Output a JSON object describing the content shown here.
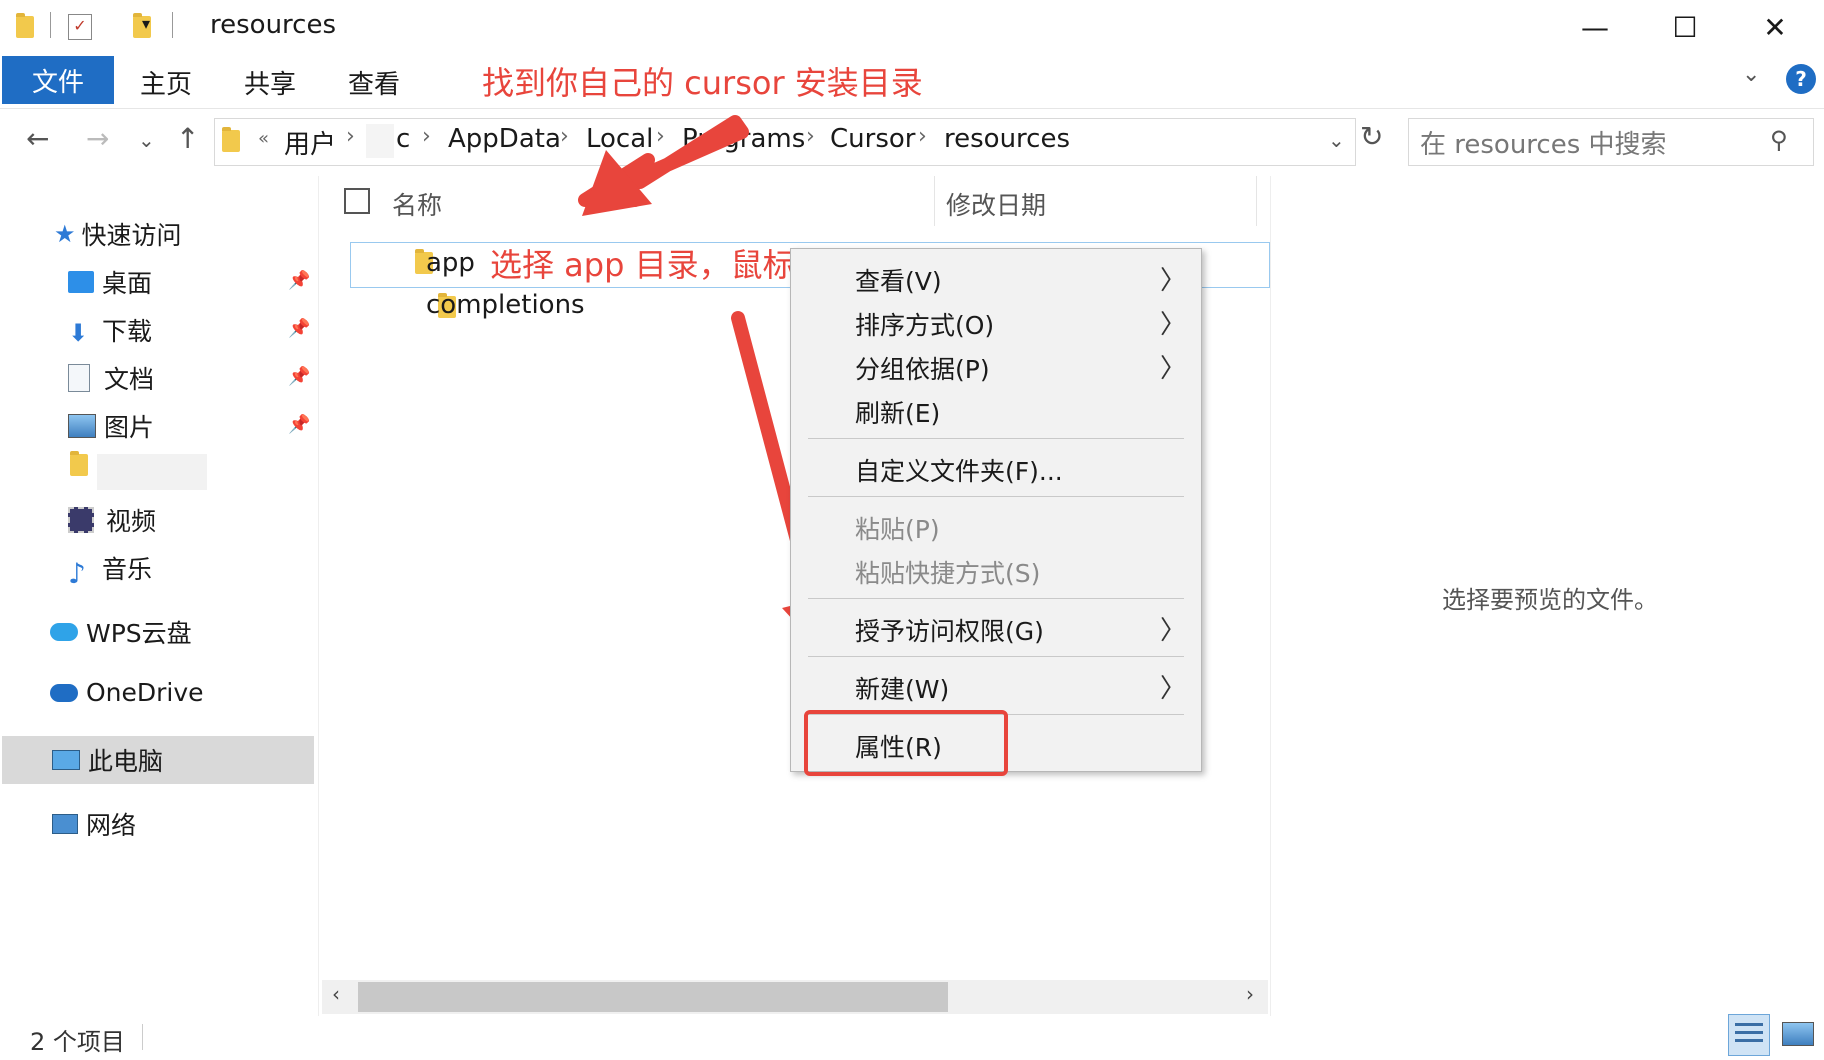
{
  "window": {
    "title": "resources",
    "controls": {
      "minimize": "—",
      "maximize": "☐",
      "close": "✕"
    }
  },
  "ribbon": {
    "tabs": [
      "文件",
      "主页",
      "共享",
      "查看"
    ],
    "help": "?"
  },
  "annotations": {
    "top": "找到你自己的 cursor 安装目录",
    "select": "选择 app 目录，鼠标右键"
  },
  "address": {
    "prefix": "«",
    "crumbs": [
      "用户",
      "c",
      "AppData",
      "Local",
      "Programs",
      "Cursor",
      "resources"
    ],
    "search_placeholder": "在 resources 中搜索"
  },
  "sidebar": {
    "quick_access": "快速访问",
    "items": [
      {
        "label": "桌面",
        "icon": "desktop-icon",
        "pinned": true
      },
      {
        "label": "下载",
        "icon": "download-icon",
        "pinned": true
      },
      {
        "label": "文档",
        "icon": "document-icon",
        "pinned": true
      },
      {
        "label": "图片",
        "icon": "picture-icon",
        "pinned": true
      },
      {
        "label": "视频",
        "icon": "video-icon",
        "pinned": false
      },
      {
        "label": "音乐",
        "icon": "music-icon",
        "pinned": false
      }
    ],
    "wps": "WPS云盘",
    "onedrive": "OneDrive",
    "this_pc": "此电脑",
    "network": "网络"
  },
  "content": {
    "headers": {
      "name": "名称",
      "modified": "修改日期"
    },
    "files": [
      "app",
      "completions"
    ],
    "preview_text": "选择要预览的文件。"
  },
  "context_menu": {
    "items": [
      {
        "label": "查看(V)",
        "submenu": true,
        "disabled": false
      },
      {
        "label": "排序方式(O)",
        "submenu": true,
        "disabled": false
      },
      {
        "label": "分组依据(P)",
        "submenu": true,
        "disabled": false
      },
      {
        "label": "刷新(E)",
        "submenu": false,
        "disabled": false
      },
      {
        "label": "自定义文件夹(F)...",
        "submenu": false,
        "disabled": false
      },
      {
        "label": "粘贴(P)",
        "submenu": false,
        "disabled": true
      },
      {
        "label": "粘贴快捷方式(S)",
        "submenu": false,
        "disabled": true
      },
      {
        "label": "授予访问权限(G)",
        "submenu": true,
        "disabled": false
      },
      {
        "label": "新建(W)",
        "submenu": true,
        "disabled": false
      },
      {
        "label": "属性(R)",
        "submenu": false,
        "disabled": false
      }
    ]
  },
  "status": {
    "count": "2 个项目"
  },
  "colors": {
    "accent": "#1f6dc4",
    "annotation": "#e8453c"
  }
}
